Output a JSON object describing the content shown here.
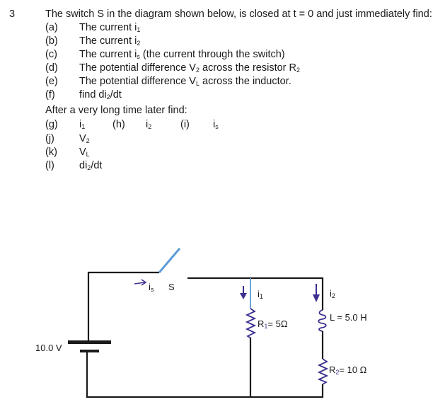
{
  "question": {
    "number": "3",
    "intro": "The switch S in the diagram shown below, is closed at t = 0 and just immediately find:",
    "immediate_parts": [
      {
        "label": "(a)",
        "text": "The current i",
        "sub": "1",
        "tail": ""
      },
      {
        "label": "(b)",
        "text": "The current i",
        "sub": "2",
        "tail": ""
      },
      {
        "label": "(c)",
        "text": "The current i",
        "sub": "s",
        "tail": " (the current through the switch)"
      },
      {
        "label": "(d)",
        "text": "The potential difference V",
        "sub": "2",
        "tail": " across the resistor R",
        "sub2": "2"
      },
      {
        "label": "(e)",
        "text": "The potential difference V",
        "sub": "L",
        "tail": " across the inductor."
      },
      {
        "label": "(f)",
        "text": "find di",
        "sub": "2",
        "tail": "/dt"
      }
    ],
    "later_heading": "After a very long time later find:",
    "later_parts": {
      "g": {
        "label": "(g)",
        "text": "i",
        "sub": "1"
      },
      "h": {
        "label": "(h)",
        "text": "i",
        "sub": "2"
      },
      "i": {
        "label": "(i)",
        "text": "i",
        "sub": "s"
      },
      "j": {
        "label": "(j)",
        "text": "V",
        "sub": "2"
      },
      "k": {
        "label": "(k)",
        "text": "V",
        "sub": "L"
      },
      "l": {
        "label": "(l)",
        "text": "di",
        "sub": "2",
        "tail": "/dt"
      }
    }
  },
  "circuit": {
    "battery_label": "10.0 V",
    "switch_label": "S",
    "switch_current": {
      "text": "i",
      "sub": "s"
    },
    "branch1_current": {
      "text": "i",
      "sub": "1"
    },
    "branch2_current": {
      "text": "i",
      "sub": "2"
    },
    "r1_label": {
      "text": "R",
      "sub": "1",
      "tail": "= 5Ω"
    },
    "inductor_label": "L = 5.0 H",
    "r2_label": {
      "text": "R",
      "sub": "2",
      "tail": "= 10 Ω"
    },
    "colors": {
      "wire": "#1a1a1a",
      "blue_wire": "#5b9bd5",
      "ink": "#3b2f8f"
    }
  }
}
